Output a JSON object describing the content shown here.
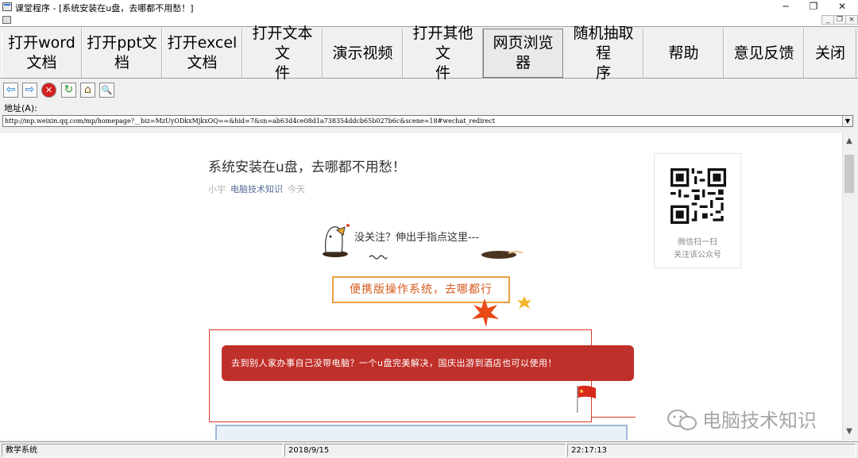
{
  "window": {
    "title": "课堂程序 - [系统安装在u盘，去哪都不用愁！]",
    "controls": {
      "minimize": "─",
      "maximize": "❐",
      "close": "✕"
    },
    "mdi_controls": [
      "_",
      "❐",
      "×"
    ]
  },
  "toolbar": {
    "buttons": [
      {
        "line1": "打开word",
        "line2": "文档"
      },
      {
        "line1": "打开ppt文",
        "line2": "档"
      },
      {
        "line1": "打开excel",
        "line2": "文档"
      },
      {
        "line1": "打开文本文",
        "line2": "件"
      },
      {
        "line1": "演示视频",
        "line2": ""
      },
      {
        "line1": "打开其他文",
        "line2": "件"
      },
      {
        "line1": "网页浏览",
        "line2": "器"
      },
      {
        "line1": "随机抽取程",
        "line2": "序"
      },
      {
        "line1": "帮助",
        "line2": ""
      },
      {
        "line1": "意见反馈",
        "line2": ""
      },
      {
        "line1": "关闭",
        "line2": ""
      }
    ]
  },
  "nav": {
    "icons": [
      "back-icon",
      "forward-icon",
      "stop-icon",
      "refresh-icon",
      "home-icon",
      "search-icon"
    ],
    "glyphs": [
      "⇦",
      "⇨",
      "✕",
      "↻",
      "⌂",
      "🔍"
    ],
    "address_label": "地址(A):",
    "address_value": "http://mp.weixin.qq.com/mp/homepage?__biz=MzUyODkxMjkxOQ==&hid=7&sn=ab63d4ce08d1a738354ddcb65b027b6c&scene=18#wechat_redirect"
  },
  "article": {
    "title": "系统安装在u盘，去哪都不用愁！",
    "author": "小宇",
    "account": "电脑技术知识",
    "date": "今天",
    "follow_text": "没关注？伸出手指点这里---",
    "banner": "便携版操作系统，去哪都行",
    "red_text": "去到别人家办事自己没带电脑？一个u盘完美解决，国庆出游到酒店也可以使用！",
    "watermark": "电脑技术知识"
  },
  "qr_card": {
    "line1": "微信扫一扫",
    "line2": "关注该公众号"
  },
  "status": {
    "app": "教学系统",
    "date": "2018/9/15",
    "time": "22:17:13"
  },
  "colors": {
    "accent_red": "#c0302a",
    "banner_border": "#e8a040",
    "link_blue": "#576b95"
  }
}
